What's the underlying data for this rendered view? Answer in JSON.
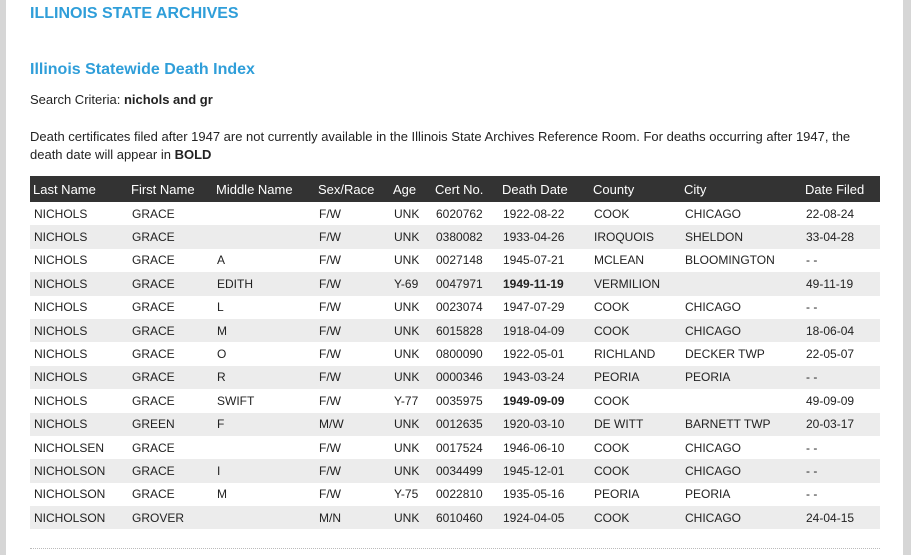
{
  "header": {
    "site_title": "ILLINOIS STATE ARCHIVES"
  },
  "main": {
    "section_title": "Illinois Statewide Death Index",
    "criteria_label": "Search Criteria:",
    "criteria_value": "nichols and gr",
    "notice_text": "Death certificates filed after 1947 are not currently available in the Illinois State Archives Reference Room. For deaths occurring after 1947, the death date will appear in",
    "notice_bold": "BOLD"
  },
  "table": {
    "columns": [
      "Last Name",
      "First Name",
      "Middle Name",
      "Sex/Race",
      "Age",
      "Cert No.",
      "Death Date",
      "County",
      "City",
      "Date Filed"
    ],
    "rows": [
      {
        "last": "NICHOLS",
        "first": "GRACE",
        "middle": "",
        "sexrace": "F/W",
        "age": "UNK",
        "cert": "6020762",
        "death": "1922-08-22",
        "bold": false,
        "county": "COOK",
        "city": "CHICAGO",
        "filed": "22-08-24"
      },
      {
        "last": "NICHOLS",
        "first": "GRACE",
        "middle": "",
        "sexrace": "F/W",
        "age": "UNK",
        "cert": "0380082",
        "death": "1933-04-26",
        "bold": false,
        "county": "IROQUOIS",
        "city": "SHELDON",
        "filed": "33-04-28"
      },
      {
        "last": "NICHOLS",
        "first": "GRACE",
        "middle": "A",
        "sexrace": "F/W",
        "age": "UNK",
        "cert": "0027148",
        "death": "1945-07-21",
        "bold": false,
        "county": "MCLEAN",
        "city": "BLOOMINGTON",
        "filed": "- -"
      },
      {
        "last": "NICHOLS",
        "first": "GRACE",
        "middle": "EDITH",
        "sexrace": "F/W",
        "age": "Y-69",
        "cert": "0047971",
        "death": "1949-11-19",
        "bold": true,
        "county": "VERMILION",
        "city": "",
        "filed": "49-11-19"
      },
      {
        "last": "NICHOLS",
        "first": "GRACE",
        "middle": "L",
        "sexrace": "F/W",
        "age": "UNK",
        "cert": "0023074",
        "death": "1947-07-29",
        "bold": false,
        "county": "COOK",
        "city": "CHICAGO",
        "filed": "- -"
      },
      {
        "last": "NICHOLS",
        "first": "GRACE",
        "middle": "M",
        "sexrace": "F/W",
        "age": "UNK",
        "cert": "6015828",
        "death": "1918-04-09",
        "bold": false,
        "county": "COOK",
        "city": "CHICAGO",
        "filed": "18-06-04"
      },
      {
        "last": "NICHOLS",
        "first": "GRACE",
        "middle": "O",
        "sexrace": "F/W",
        "age": "UNK",
        "cert": "0800090",
        "death": "1922-05-01",
        "bold": false,
        "county": "RICHLAND",
        "city": "DECKER TWP",
        "filed": "22-05-07"
      },
      {
        "last": "NICHOLS",
        "first": "GRACE",
        "middle": "R",
        "sexrace": "F/W",
        "age": "UNK",
        "cert": "0000346",
        "death": "1943-03-24",
        "bold": false,
        "county": "PEORIA",
        "city": "PEORIA",
        "filed": "- -"
      },
      {
        "last": "NICHOLS",
        "first": "GRACE",
        "middle": "SWIFT",
        "sexrace": "F/W",
        "age": "Y-77",
        "cert": "0035975",
        "death": "1949-09-09",
        "bold": true,
        "county": "COOK",
        "city": "",
        "filed": "49-09-09"
      },
      {
        "last": "NICHOLS",
        "first": "GREEN",
        "middle": "F",
        "sexrace": "M/W",
        "age": "UNK",
        "cert": "0012635",
        "death": "1920-03-10",
        "bold": false,
        "county": "DE WITT",
        "city": "BARNETT TWP",
        "filed": "20-03-17"
      },
      {
        "last": "NICHOLSEN",
        "first": "GRACE",
        "middle": "",
        "sexrace": "F/W",
        "age": "UNK",
        "cert": "0017524",
        "death": "1946-06-10",
        "bold": false,
        "county": "COOK",
        "city": "CHICAGO",
        "filed": "- -"
      },
      {
        "last": "NICHOLSON",
        "first": "GRACE",
        "middle": "I",
        "sexrace": "F/W",
        "age": "UNK",
        "cert": "0034499",
        "death": "1945-12-01",
        "bold": false,
        "county": "COOK",
        "city": "CHICAGO",
        "filed": "- -"
      },
      {
        "last": "NICHOLSON",
        "first": "GRACE",
        "middle": "M",
        "sexrace": "F/W",
        "age": "Y-75",
        "cert": "0022810",
        "death": "1935-05-16",
        "bold": false,
        "county": "PEORIA",
        "city": "PEORIA",
        "filed": "- -"
      },
      {
        "last": "NICHOLSON",
        "first": "GROVER",
        "middle": "",
        "sexrace": "M/N",
        "age": "UNK",
        "cert": "6010460",
        "death": "1924-04-05",
        "bold": false,
        "county": "COOK",
        "city": "CHICAGO",
        "filed": "24-04-15"
      }
    ]
  }
}
